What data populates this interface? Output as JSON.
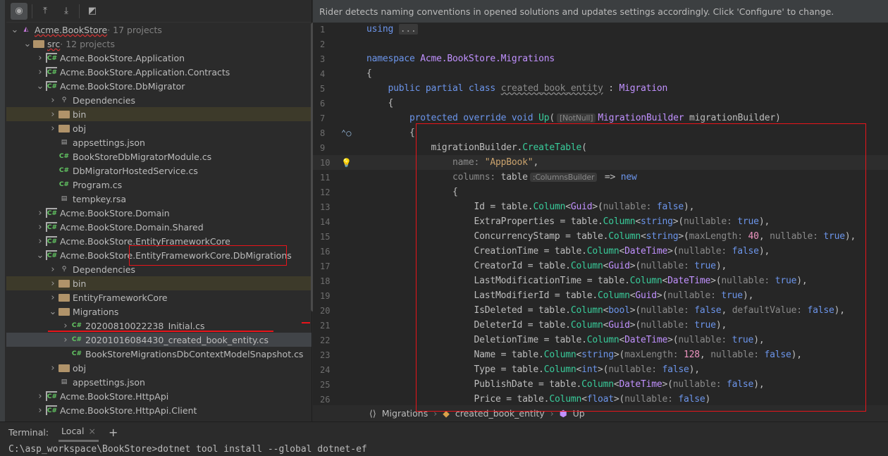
{
  "banner": "Rider detects naming conventions in opened solutions and updates settings accordingly. Click 'Configure' to change.",
  "toolbar": {
    "icons": [
      "show-files-icon",
      "collapse-all-icon",
      "expand-all-icon",
      "preview-icon"
    ]
  },
  "tree": [
    {
      "level": 0,
      "arrow": "v",
      "icon": "sln",
      "label": "Acme.BookStore",
      "suffix": " · 17 projects",
      "wavy": true
    },
    {
      "level": 1,
      "arrow": "v",
      "icon": "folder",
      "label": "src",
      "suffix": " · 12 projects",
      "wavy": true
    },
    {
      "level": 2,
      "arrow": ">",
      "icon": "proj",
      "label": "Acme.BookStore.Application"
    },
    {
      "level": 2,
      "arrow": ">",
      "icon": "proj",
      "label": "Acme.BookStore.Application.Contracts"
    },
    {
      "level": 2,
      "arrow": "v",
      "icon": "proj",
      "label": "Acme.BookStore.DbMigrator"
    },
    {
      "level": 3,
      "arrow": ">",
      "icon": "dep",
      "label": "Dependencies"
    },
    {
      "level": 3,
      "arrow": ">",
      "icon": "folder",
      "label": "bin",
      "hl": true
    },
    {
      "level": 3,
      "arrow": ">",
      "icon": "folder",
      "label": "obj"
    },
    {
      "level": 3,
      "arrow": "",
      "icon": "file",
      "label": "appsettings.json"
    },
    {
      "level": 3,
      "arrow": "",
      "icon": "cs",
      "label": "BookStoreDbMigratorModule.cs"
    },
    {
      "level": 3,
      "arrow": "",
      "icon": "cs",
      "label": "DbMigratorHostedService.cs"
    },
    {
      "level": 3,
      "arrow": "",
      "icon": "cs",
      "label": "Program.cs"
    },
    {
      "level": 3,
      "arrow": "",
      "icon": "file",
      "label": "tempkey.rsa"
    },
    {
      "level": 2,
      "arrow": ">",
      "icon": "proj",
      "label": "Acme.BookStore.Domain"
    },
    {
      "level": 2,
      "arrow": ">",
      "icon": "proj",
      "label": "Acme.BookStore.Domain.Shared"
    },
    {
      "level": 2,
      "arrow": ">",
      "icon": "proj",
      "label": "Acme.BookStore.EntityFrameworkCore"
    },
    {
      "level": 2,
      "arrow": "v",
      "icon": "proj",
      "label": "Acme.BookStore.EntityFrameworkCore.DbMigrations"
    },
    {
      "level": 3,
      "arrow": ">",
      "icon": "dep",
      "label": "Dependencies"
    },
    {
      "level": 3,
      "arrow": ">",
      "icon": "folder",
      "label": "bin",
      "hl": true
    },
    {
      "level": 3,
      "arrow": ">",
      "icon": "folder",
      "label": "EntityFrameworkCore"
    },
    {
      "level": 3,
      "arrow": "v",
      "icon": "folder",
      "label": "Migrations"
    },
    {
      "level": 4,
      "arrow": ">",
      "icon": "cs",
      "label": "20200810022238_Initial.cs"
    },
    {
      "level": 4,
      "arrow": ">",
      "icon": "cs",
      "label": "20201016084430_created_book_entity.cs",
      "sel": true
    },
    {
      "level": 4,
      "arrow": "",
      "icon": "cs",
      "label": "BookStoreMigrationsDbContextModelSnapshot.cs"
    },
    {
      "level": 3,
      "arrow": ">",
      "icon": "folder",
      "label": "obj"
    },
    {
      "level": 3,
      "arrow": "",
      "icon": "file",
      "label": "appsettings.json"
    },
    {
      "level": 2,
      "arrow": ">",
      "icon": "proj",
      "label": "Acme.BookStore.HttpApi"
    },
    {
      "level": 2,
      "arrow": ">",
      "icon": "proj",
      "label": "Acme.BookStore.HttpApi.Client"
    }
  ],
  "code": [
    [
      [
        "kw",
        "using "
      ],
      [
        "fold",
        "..."
      ]
    ],
    [],
    [
      [
        "kw",
        "namespace "
      ],
      [
        "ty",
        "Acme.BookStore.Migrations"
      ]
    ],
    [
      [
        "pl",
        "{"
      ]
    ],
    [
      [
        "pl",
        "    "
      ],
      [
        "kw",
        "public partial class "
      ],
      [
        "un",
        "created_book_entity"
      ],
      [
        "pl",
        " : "
      ],
      [
        "ty",
        "Migration"
      ]
    ],
    [
      [
        "pl",
        "    {"
      ]
    ],
    [
      [
        "pl",
        "        "
      ],
      [
        "kw",
        "protected override void "
      ],
      [
        "me",
        "Up"
      ],
      [
        "pl",
        "("
      ],
      [
        "hint",
        "[NotNull]"
      ],
      [
        "ty",
        "MigrationBuilder "
      ],
      [
        "pl",
        "migrationBuilder)"
      ]
    ],
    [
      [
        "pl",
        "        {"
      ]
    ],
    [
      [
        "pl",
        "            migrationBuilder."
      ],
      [
        "me",
        "CreateTable"
      ],
      [
        "pl",
        "("
      ]
    ],
    [
      [
        "pl",
        "                "
      ],
      [
        "pa",
        "name: "
      ],
      [
        "st",
        "\"AppBook\""
      ],
      [
        "pl",
        ","
      ]
    ],
    [
      [
        "pl",
        "                "
      ],
      [
        "pa",
        "columns: "
      ],
      [
        "pl",
        "table"
      ],
      [
        "hint",
        ":ColumnsBuilder"
      ],
      [
        "pl",
        " => "
      ],
      [
        "kw",
        "new"
      ]
    ],
    [
      [
        "pl",
        "                {"
      ]
    ],
    [
      [
        "pl",
        "                    Id = table."
      ],
      [
        "me",
        "Column"
      ],
      [
        "pl",
        "<"
      ],
      [
        "ty",
        "Guid"
      ],
      [
        "pl",
        ">("
      ],
      [
        "pa",
        "nullable: "
      ],
      [
        "kw",
        "false"
      ],
      [
        "pl",
        "),"
      ]
    ],
    [
      [
        "pl",
        "                    ExtraProperties = table."
      ],
      [
        "me",
        "Column"
      ],
      [
        "pl",
        "<"
      ],
      [
        "kw",
        "string"
      ],
      [
        "pl",
        ">("
      ],
      [
        "pa",
        "nullable: "
      ],
      [
        "kw",
        "true"
      ],
      [
        "pl",
        "),"
      ]
    ],
    [
      [
        "pl",
        "                    ConcurrencyStamp = table."
      ],
      [
        "me",
        "Column"
      ],
      [
        "pl",
        "<"
      ],
      [
        "kw",
        "string"
      ],
      [
        "pl",
        ">("
      ],
      [
        "pa",
        "maxLength: "
      ],
      [
        "nu",
        "40"
      ],
      [
        "pl",
        ", "
      ],
      [
        "pa",
        "nullable: "
      ],
      [
        "kw",
        "true"
      ],
      [
        "pl",
        "),"
      ]
    ],
    [
      [
        "pl",
        "                    CreationTime = table."
      ],
      [
        "me",
        "Column"
      ],
      [
        "pl",
        "<"
      ],
      [
        "ty",
        "DateTime"
      ],
      [
        "pl",
        ">("
      ],
      [
        "pa",
        "nullable: "
      ],
      [
        "kw",
        "false"
      ],
      [
        "pl",
        "),"
      ]
    ],
    [
      [
        "pl",
        "                    CreatorId = table."
      ],
      [
        "me",
        "Column"
      ],
      [
        "pl",
        "<"
      ],
      [
        "ty",
        "Guid"
      ],
      [
        "pl",
        ">("
      ],
      [
        "pa",
        "nullable: "
      ],
      [
        "kw",
        "true"
      ],
      [
        "pl",
        "),"
      ]
    ],
    [
      [
        "pl",
        "                    LastModificationTime = table."
      ],
      [
        "me",
        "Column"
      ],
      [
        "pl",
        "<"
      ],
      [
        "ty",
        "DateTime"
      ],
      [
        "pl",
        ">("
      ],
      [
        "pa",
        "nullable: "
      ],
      [
        "kw",
        "true"
      ],
      [
        "pl",
        "),"
      ]
    ],
    [
      [
        "pl",
        "                    LastModifierId = table."
      ],
      [
        "me",
        "Column"
      ],
      [
        "pl",
        "<"
      ],
      [
        "ty",
        "Guid"
      ],
      [
        "pl",
        ">("
      ],
      [
        "pa",
        "nullable: "
      ],
      [
        "kw",
        "true"
      ],
      [
        "pl",
        "),"
      ]
    ],
    [
      [
        "pl",
        "                    IsDeleted = table."
      ],
      [
        "me",
        "Column"
      ],
      [
        "pl",
        "<"
      ],
      [
        "kw",
        "bool"
      ],
      [
        "pl",
        ">("
      ],
      [
        "pa",
        "nullable: "
      ],
      [
        "kw",
        "false"
      ],
      [
        "pl",
        ", "
      ],
      [
        "pa",
        "defaultValue: "
      ],
      [
        "kw",
        "false"
      ],
      [
        "pl",
        "),"
      ]
    ],
    [
      [
        "pl",
        "                    DeleterId = table."
      ],
      [
        "me",
        "Column"
      ],
      [
        "pl",
        "<"
      ],
      [
        "ty",
        "Guid"
      ],
      [
        "pl",
        ">("
      ],
      [
        "pa",
        "nullable: "
      ],
      [
        "kw",
        "true"
      ],
      [
        "pl",
        "),"
      ]
    ],
    [
      [
        "pl",
        "                    DeletionTime = table."
      ],
      [
        "me",
        "Column"
      ],
      [
        "pl",
        "<"
      ],
      [
        "ty",
        "DateTime"
      ],
      [
        "pl",
        ">("
      ],
      [
        "pa",
        "nullable: "
      ],
      [
        "kw",
        "true"
      ],
      [
        "pl",
        "),"
      ]
    ],
    [
      [
        "pl",
        "                    Name = table."
      ],
      [
        "me",
        "Column"
      ],
      [
        "pl",
        "<"
      ],
      [
        "kw",
        "string"
      ],
      [
        "pl",
        ">("
      ],
      [
        "pa",
        "maxLength: "
      ],
      [
        "nu",
        "128"
      ],
      [
        "pl",
        ", "
      ],
      [
        "pa",
        "nullable: "
      ],
      [
        "kw",
        "false"
      ],
      [
        "pl",
        "),"
      ]
    ],
    [
      [
        "pl",
        "                    Type = table."
      ],
      [
        "me",
        "Column"
      ],
      [
        "pl",
        "<"
      ],
      [
        "kw",
        "int"
      ],
      [
        "pl",
        ">("
      ],
      [
        "pa",
        "nullable: "
      ],
      [
        "kw",
        "false"
      ],
      [
        "pl",
        "),"
      ]
    ],
    [
      [
        "pl",
        "                    PublishDate = table."
      ],
      [
        "me",
        "Column"
      ],
      [
        "pl",
        "<"
      ],
      [
        "ty",
        "DateTime"
      ],
      [
        "pl",
        ">("
      ],
      [
        "pa",
        "nullable: "
      ],
      [
        "kw",
        "false"
      ],
      [
        "pl",
        "),"
      ]
    ],
    [
      [
        "pl",
        "                    Price = table."
      ],
      [
        "me",
        "Column"
      ],
      [
        "pl",
        "<"
      ],
      [
        "kw",
        "float"
      ],
      [
        "pl",
        ">("
      ],
      [
        "pa",
        "nullable: "
      ],
      [
        "kw",
        "false"
      ],
      [
        "pl",
        ")"
      ]
    ]
  ],
  "current_line": 10,
  "breadcrumb": [
    "Migrations",
    "created_book_entity",
    "Up"
  ],
  "terminal": {
    "label": "Terminal:",
    "tab": "Local",
    "add": "+",
    "close": "×",
    "command": "C:\\asp_workspace\\BookStore>dotnet tool install --global dotnet-ef"
  },
  "colors": {
    "annotation": "#e8141a",
    "keyword": "#6c95eb",
    "type": "#c191ff",
    "method": "#39cc9b",
    "string": "#c9a26d"
  }
}
